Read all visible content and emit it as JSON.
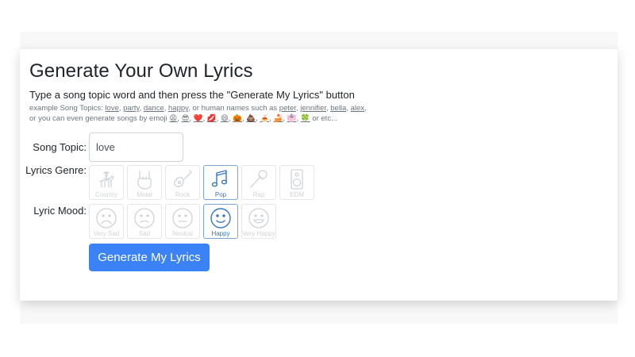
{
  "page": {
    "title": "Generate Your Own Lyrics",
    "instruction": "Type a song topic word and then press the \"Generate My Lyrics\" button",
    "examples_prefix": "example Song Topics: ",
    "examples_words": [
      "love",
      "party",
      "dance",
      "happy"
    ],
    "examples_mid": ", or human names such as ",
    "examples_names": [
      "peter",
      "jennifier",
      "bella",
      "alex"
    ],
    "examples_line2": "or you can even generate songs by emoji",
    "examples_emoji": [
      "😩",
      "😎",
      "❤️",
      "💋",
      "😄",
      "🎃",
      "💩",
      "🍝",
      "🍰",
      "👘",
      "🍀"
    ],
    "examples_suffix": "or etc..."
  },
  "form": {
    "topic_label": "Song Topic:",
    "topic_value": "love",
    "genre_label": "Lyrics Genre:",
    "mood_label": "Lyric Mood:",
    "genres": [
      {
        "label": "Country",
        "icon": "cowboy-horse-icon",
        "selected": false
      },
      {
        "label": "Metal",
        "icon": "rock-hand-icon",
        "selected": false
      },
      {
        "label": "Rock",
        "icon": "electric-guitar-icon",
        "selected": false
      },
      {
        "label": "Pop",
        "icon": "music-notes-icon",
        "selected": true
      },
      {
        "label": "Rap",
        "icon": "microphone-icon",
        "selected": false
      },
      {
        "label": "EDM",
        "icon": "speaker-icon",
        "selected": false
      }
    ],
    "moods": [
      {
        "label": "Very Sad",
        "icon": "very-sad-face-icon",
        "selected": false
      },
      {
        "label": "Sad",
        "icon": "sad-face-icon",
        "selected": false
      },
      {
        "label": "Neutral",
        "icon": "neutral-face-icon",
        "selected": false
      },
      {
        "label": "Happy",
        "icon": "happy-face-icon",
        "selected": true
      },
      {
        "label": "Very Happy",
        "icon": "very-happy-face-icon",
        "selected": false
      }
    ],
    "generate_button": "Generate My Lyrics"
  },
  "colors": {
    "button": "#3b82f6",
    "selected_border": "#7aa5d3",
    "selected_icon": "#3a78bd",
    "disabled_icon": "#d0d3d6"
  }
}
